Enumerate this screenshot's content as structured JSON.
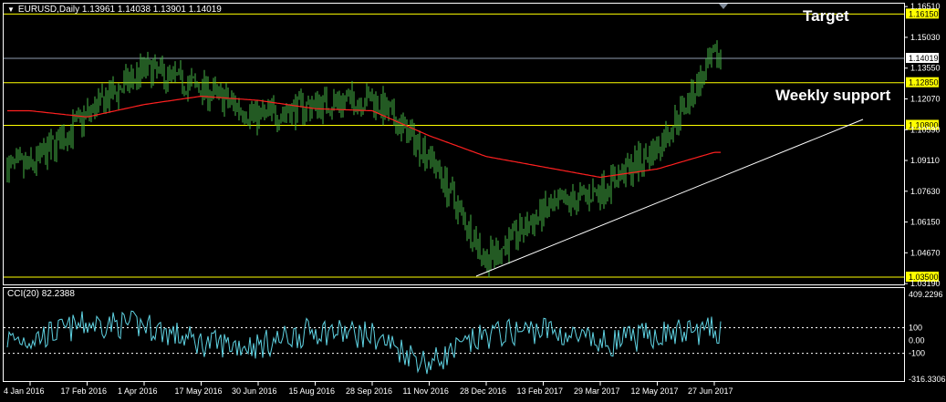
{
  "header": {
    "symbol_line": "EURUSD,Daily  1.13961 1.14038 1.13901 1.14019",
    "menu_arrow": "triangle-down-icon"
  },
  "annotations": {
    "target": "Target",
    "weekly_support": "Weekly support"
  },
  "price_axis": {
    "ticks": [
      "1.16510",
      "1.15030",
      "1.13550",
      "1.12070",
      "1.10590",
      "1.09110",
      "1.07630",
      "1.06150",
      "1.04670",
      "1.03190"
    ],
    "ymin": 1.0315,
    "ymax": 1.1665
  },
  "levels": [
    {
      "label": "1.16150",
      "value": 1.1615,
      "color": "#ffff00"
    },
    {
      "label": "1.12850",
      "value": 1.1285,
      "color": "#ffff00"
    },
    {
      "label": "1.10800",
      "value": 1.108,
      "color": "#ffff00"
    },
    {
      "label": "1.03500",
      "value": 1.035,
      "color": "#ffff00"
    }
  ],
  "current_price": {
    "label": "1.14019",
    "value": 1.14019,
    "color": "#ffffff"
  },
  "cci": {
    "title": "CCI(20) 82.2388",
    "ticks": [
      "409.2296",
      "100",
      "0.00",
      "-100",
      "-316.3306"
    ],
    "ymin": -316.33,
    "ymax": 409.23,
    "color": "#5fd3e3"
  },
  "date_axis": {
    "labels": [
      "4 Jan 2016",
      "17 Feb 2016",
      "1 Apr 2016",
      "17 May 2016",
      "30 Jun 2016",
      "15 Aug 2016",
      "28 Sep 2016",
      "11 Nov 2016",
      "28 Dec 2016",
      "13 Feb 2017",
      "29 Mar 2017",
      "12 May 2017",
      "27 Jun 2017"
    ]
  },
  "colors": {
    "candle": "#46b446",
    "ma": "#ff2020",
    "trendline": "#ffffff",
    "level": "#ffff00",
    "background": "#000000"
  },
  "chart_data": {
    "type": "line",
    "title": "EURUSD,Daily",
    "x": [
      "4 Jan 2016",
      "17 Feb 2016",
      "1 Apr 2016",
      "17 May 2016",
      "30 Jun 2016",
      "15 Aug 2016",
      "28 Sep 2016",
      "11 Nov 2016",
      "28 Dec 2016",
      "13 Feb 2017",
      "29 Mar 2017",
      "12 May 2017",
      "27 Jun 2017"
    ],
    "series": [
      {
        "name": "",
        "values": [
          1.088,
          1.113,
          1.135,
          1.126,
          1.112,
          1.118,
          1.121,
          1.094,
          1.043,
          1.066,
          1.077,
          1.097,
          1.14
        ]
      }
    ],
    "ma_series": [
      1.115,
      1.112,
      1.118,
      1.122,
      1.12,
      1.116,
      1.115,
      1.103,
      1.093,
      1.088,
      1.083,
      1.087,
      1.095
    ],
    "ylim": [
      1.0319,
      1.1651
    ],
    "cci_values": [
      10,
      130,
      120,
      -20,
      -40,
      80,
      40,
      -180,
      40,
      90,
      -30,
      50,
      80
    ]
  }
}
